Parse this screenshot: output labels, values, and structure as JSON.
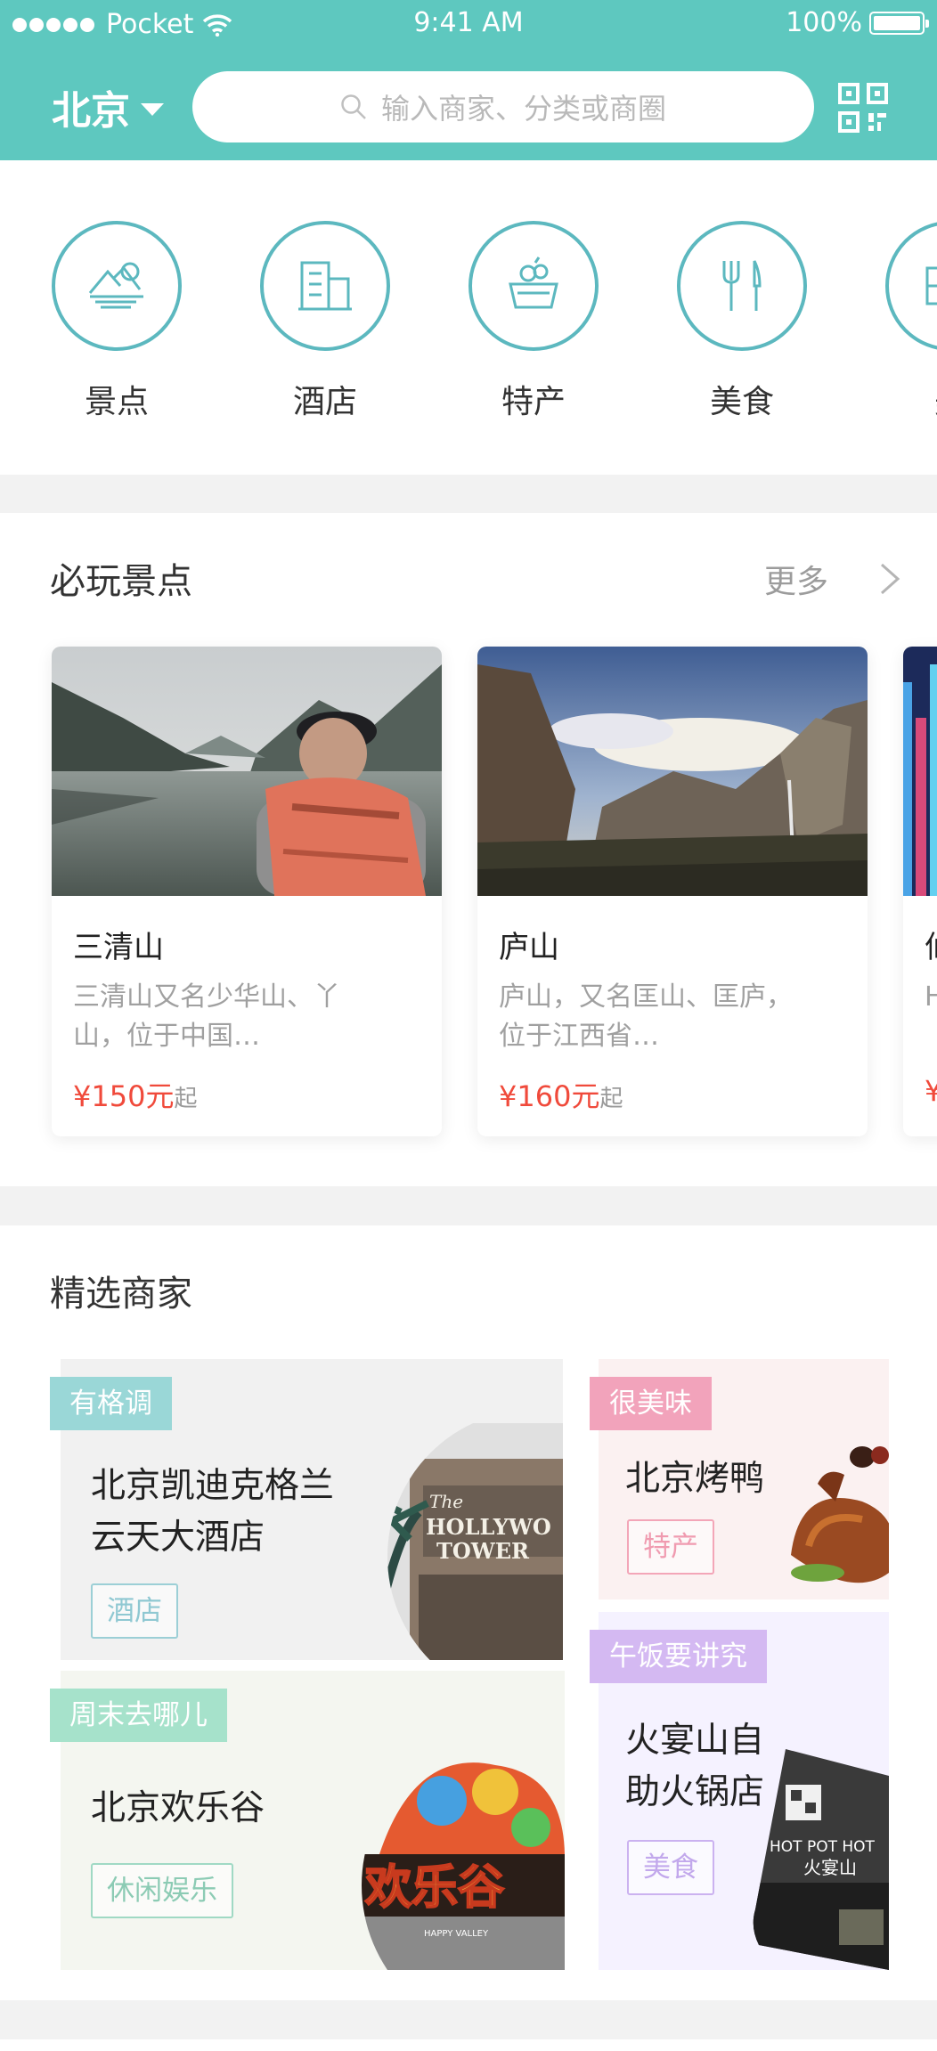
{
  "status": {
    "carrier": "Pocket",
    "time": "9:41 AM",
    "battery": "100%"
  },
  "header": {
    "city": "北京",
    "search_placeholder": "输入商家、分类或商圈"
  },
  "categories": [
    {
      "label": "景点",
      "icon": "scenery-icon"
    },
    {
      "label": "酒店",
      "icon": "hotel-icon"
    },
    {
      "label": "特产",
      "icon": "specialty-icon"
    },
    {
      "label": "美食",
      "icon": "food-icon"
    },
    {
      "label": "美",
      "icon": "category-icon"
    }
  ],
  "spots": {
    "title": "必玩景点",
    "more": "更多",
    "cards": [
      {
        "name": "三清山",
        "desc": "三清山又名少华山、丫山，位于中国…",
        "price": "¥150元",
        "price_suffix": "起"
      },
      {
        "name": "庐山",
        "desc": "庐山，又名匡山、匡庐，位于江西省…",
        "price": "¥160元",
        "price_suffix": "起"
      },
      {
        "name": "仙",
        "desc": "H C",
        "price": "¥"
      }
    ]
  },
  "merchants": {
    "title": "精选商家",
    "cards": [
      {
        "tag": "有格调",
        "name_line1": "北京凯迪克格兰",
        "name_line2": "云天大酒店",
        "badge": "酒店",
        "image_text_1": "The",
        "image_text_2": "HOLLYWO",
        "image_text_3": "TOWER"
      },
      {
        "tag": "很美味",
        "name": "北京烤鸭",
        "badge": "特产"
      },
      {
        "tag": "周末去哪儿",
        "name": "北京欢乐谷",
        "badge": "休闲娱乐",
        "image_text_1": "欢乐谷",
        "image_text_2": "HAPPY VALLEY"
      },
      {
        "tag": "午饭要讲究",
        "name_line1": "火宴山自",
        "name_line2": "助火锅店",
        "badge": "美食",
        "image_text_1": "HOT POT HOT",
        "image_text_2": "火宴山"
      }
    ]
  },
  "colors": {
    "primary": "#5ec8bf",
    "icon_ring": "#5cb8bf",
    "price": "#f04a3b",
    "tag_teal": "#9ad7d7",
    "tag_pink": "#f2a3bb",
    "tag_green": "#a6e2cb",
    "tag_purple": "#d4b9f2"
  }
}
